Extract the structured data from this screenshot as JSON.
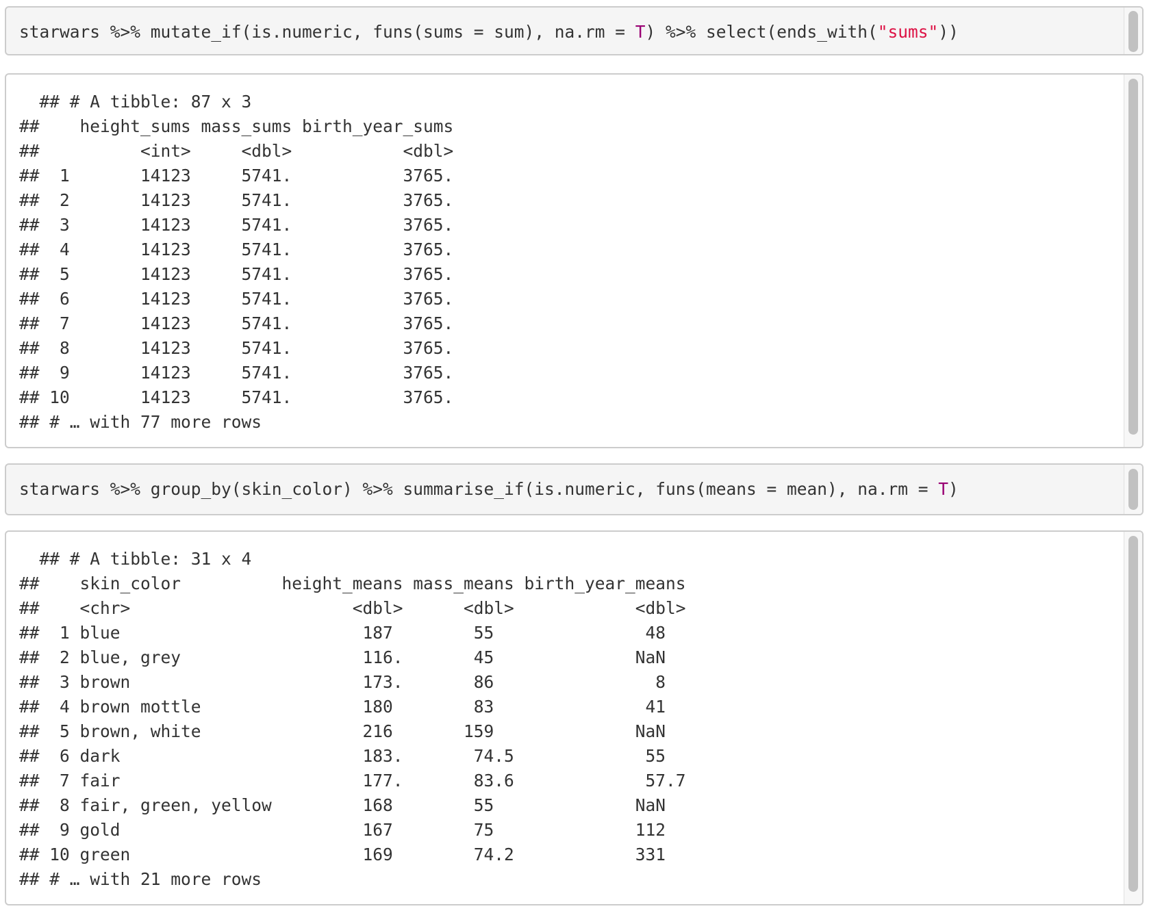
{
  "chunks": [
    {
      "type": "code",
      "segments": [
        {
          "text": "starwars %>% mutate_if(is.numeric, funs(sums = sum), na.rm = ",
          "token": "plain"
        },
        {
          "text": "T",
          "token": "literal"
        },
        {
          "text": ") %>% select(ends_with(",
          "token": "plain"
        },
        {
          "text": "\"sums\"",
          "token": "string"
        },
        {
          "text": "))",
          "token": "plain"
        }
      ]
    },
    {
      "type": "output",
      "lines": [
        "  ## # A tibble: 87 x 3",
        "##    height_sums mass_sums birth_year_sums",
        "##          <int>     <dbl>           <dbl>",
        "##  1       14123     5741.           3765.",
        "##  2       14123     5741.           3765.",
        "##  3       14123     5741.           3765.",
        "##  4       14123     5741.           3765.",
        "##  5       14123     5741.           3765.",
        "##  6       14123     5741.           3765.",
        "##  7       14123     5741.           3765.",
        "##  8       14123     5741.           3765.",
        "##  9       14123     5741.           3765.",
        "## 10       14123     5741.           3765.",
        "## # … with 77 more rows"
      ]
    },
    {
      "type": "code",
      "segments": [
        {
          "text": "starwars %>% group_by(skin_color) %>% summarise_if(is.numeric, funs(means = mean), na.rm = ",
          "token": "plain"
        },
        {
          "text": "T",
          "token": "literal"
        },
        {
          "text": ")",
          "token": "plain"
        }
      ]
    },
    {
      "type": "output",
      "lines": [
        "  ## # A tibble: 31 x 4",
        "##    skin_color          height_means mass_means birth_year_means",
        "##    <chr>                      <dbl>      <dbl>            <dbl>",
        "##  1 blue                        187        55               48  ",
        "##  2 blue, grey                  116.       45              NaN  ",
        "##  3 brown                       173.       86                8  ",
        "##  4 brown mottle                180        83               41  ",
        "##  5 brown, white                216       159              NaN  ",
        "##  6 dark                        183.       74.5             55  ",
        "##  7 fair                        177.       83.6             57.7",
        "##  8 fair, green, yellow         168        55              NaN  ",
        "##  9 gold                        167        75              112  ",
        "## 10 green                       169        74.2            331  ",
        "## # … with 21 more rows"
      ]
    }
  ]
}
